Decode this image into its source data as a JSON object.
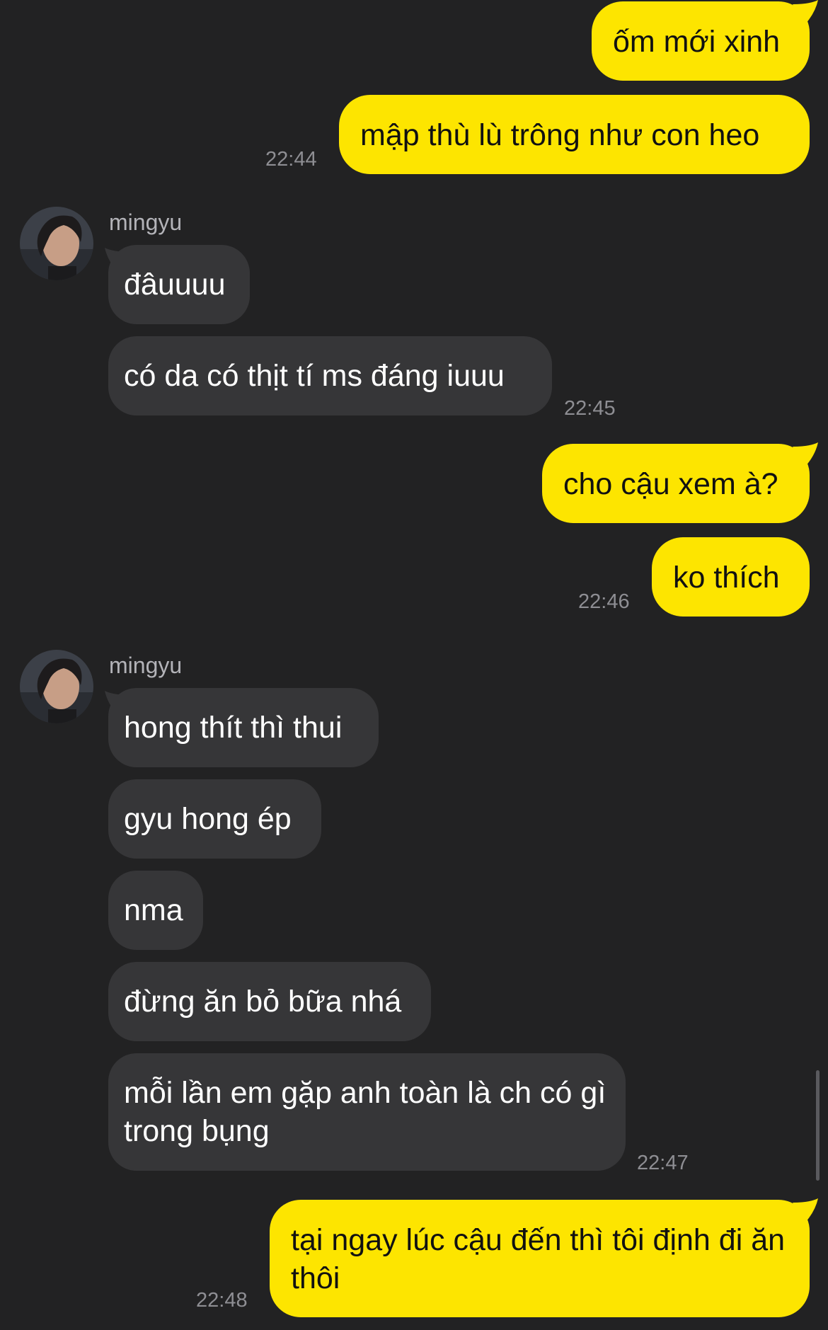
{
  "colors": {
    "background": "#222223",
    "my_bubble": "#FDE500",
    "their_bubble": "#363638",
    "timestamp": "#8E8E93"
  },
  "contact": {
    "name": "mingyu",
    "avatar_icon": "profile-photo"
  },
  "messages": [
    {
      "side": "me",
      "text": "ốm mới xinh"
    },
    {
      "side": "me",
      "text": "mập thù lù trông như con heo",
      "time": "22:44"
    },
    {
      "side": "them",
      "text": "đâuuuu"
    },
    {
      "side": "them",
      "text": "có da có thịt tí ms đáng iuuu",
      "time": "22:45"
    },
    {
      "side": "me",
      "text": "cho cậu xem à?"
    },
    {
      "side": "me",
      "text": "ko thích",
      "time": "22:46"
    },
    {
      "side": "them",
      "text": "hong thít thì thui"
    },
    {
      "side": "them",
      "text": "gyu hong ép"
    },
    {
      "side": "them",
      "text": "nma"
    },
    {
      "side": "them",
      "text": "đừng ăn bỏ bữa nhá"
    },
    {
      "side": "them",
      "text": "mỗi lần em gặp anh toàn là ch có gì trong bụng",
      "time": "22:47"
    },
    {
      "side": "me",
      "text": "tại ngay lúc cậu đến thì tôi định đi ăn thôi",
      "time": "22:48"
    }
  ]
}
